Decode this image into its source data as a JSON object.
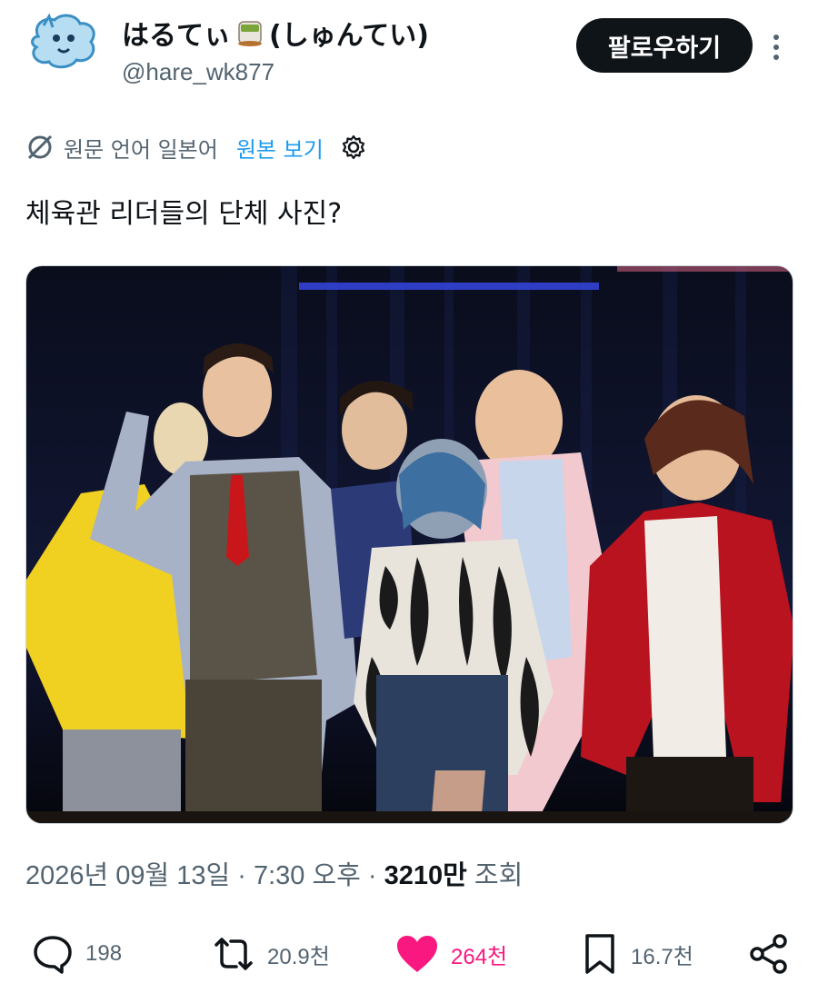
{
  "profile": {
    "display_name_start": "はるてぃ",
    "display_name_end": "(しゅんてい)",
    "handle": "@hare_wk877",
    "follow_label": "팔로우하기"
  },
  "translation": {
    "source_language": "원문 언어 일본어",
    "show_original": "원본 보기"
  },
  "post": {
    "text": "체육관 리더들의 단체 사진?"
  },
  "meta": {
    "date": "2026년 09월 13일",
    "separator1": " · ",
    "time": "7:30 오후",
    "separator2": " · ",
    "views_count": "3210만",
    "views_label": " 조회"
  },
  "actions": {
    "replies": "198",
    "reposts": "20.9천",
    "likes": "264천",
    "bookmarks": "16.7천"
  },
  "colors": {
    "accent": "#1d9bf0",
    "like": "#f91880",
    "text": "#0f1419",
    "muted": "#536471"
  },
  "icons": [
    "avatar-mascot",
    "tea-cup-emoji",
    "more-vertical-icon",
    "translate-icon",
    "gear-icon",
    "reply-icon",
    "repost-icon",
    "heart-icon",
    "bookmark-icon",
    "share-icon"
  ]
}
